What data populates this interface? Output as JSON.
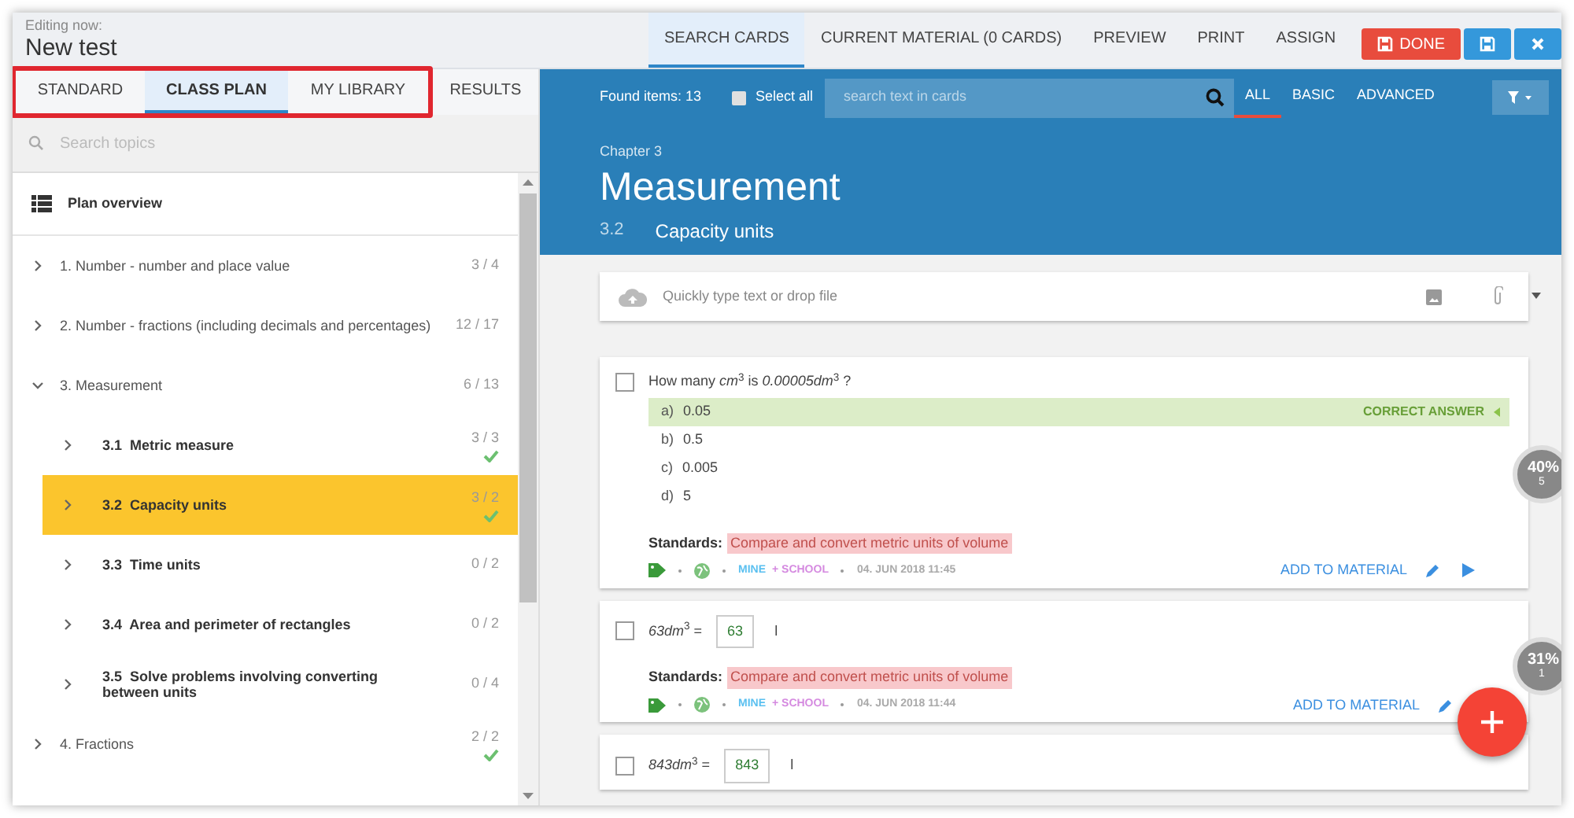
{
  "header": {
    "caption": "Editing now:",
    "title": "New test"
  },
  "top_tabs": [
    {
      "label": "SEARCH CARDS",
      "selected": true
    },
    {
      "label": "CURRENT MATERIAL (0 CARDS)",
      "selected": false
    },
    {
      "label": "PREVIEW",
      "selected": false
    },
    {
      "label": "PRINT",
      "selected": false
    },
    {
      "label": "ASSIGN",
      "selected": false
    }
  ],
  "actions": [
    {
      "kind": "done",
      "label": "DONE"
    },
    {
      "kind": "save"
    },
    {
      "kind": "close"
    }
  ],
  "side_tabs": [
    {
      "label": "STANDARD",
      "selected": false,
      "highlighted": true
    },
    {
      "label": "CLASS PLAN",
      "selected": true,
      "highlighted": true
    },
    {
      "label": "MY LIBRARY",
      "selected": false,
      "highlighted": true
    },
    {
      "label": "RESULTS",
      "selected": false,
      "highlighted": false
    }
  ],
  "topic_search": {
    "placeholder": "Search topics"
  },
  "plan_overview": {
    "label": "Plan overview"
  },
  "topics": [
    {
      "title": "1. Number - number and place value",
      "count": "3 / 4",
      "expanded": false,
      "done": false,
      "selected": false
    },
    {
      "title": "2. Number - fractions (including decimals and percentages)",
      "count": "12 / 17",
      "expanded": false,
      "done": false,
      "selected": false
    },
    {
      "title": "3. Measurement",
      "count": "6 / 13",
      "expanded": true,
      "done": false,
      "selected": false,
      "children": [
        {
          "number": "3.1",
          "title": "Metric measure",
          "count": "3 / 3",
          "expanded": false,
          "done": true,
          "selected": false
        },
        {
          "number": "3.2",
          "title": "Capacity units",
          "count": "3 / 2",
          "expanded": false,
          "done": true,
          "selected": true
        },
        {
          "number": "3.3",
          "title": "Time units",
          "count": "0 / 2",
          "expanded": false,
          "done": false,
          "selected": false
        },
        {
          "number": "3.4",
          "title": "Area and perimeter of rectangles",
          "count": "0 / 2",
          "expanded": false,
          "done": false,
          "selected": false
        },
        {
          "number": "3.5",
          "title": "Solve problems involving converting between units",
          "count": "0 / 4",
          "expanded": false,
          "done": false,
          "selected": false
        }
      ]
    },
    {
      "title": "4. Fractions",
      "count": "2 / 2",
      "expanded": false,
      "done": true,
      "selected": false
    }
  ],
  "toolbar": {
    "found": "Found items: 13",
    "select_all": {
      "label": "Select all",
      "checked": false
    },
    "search_placeholder": "search text in cards",
    "filters": [
      {
        "label": "ALL",
        "selected": true
      },
      {
        "label": "BASIC",
        "selected": false
      },
      {
        "label": "ADVANCED",
        "selected": false
      }
    ]
  },
  "chapter": {
    "caption": "Chapter 3",
    "title": "Measurement",
    "number": "3.2",
    "subtitle": "Capacity units"
  },
  "quick_input": {
    "placeholder": "Quickly type text or drop file"
  },
  "cards": [
    {
      "kind": "choice",
      "checked": false,
      "question": "How many *cm*$^{3}$ is *0.00005dm*$^{3}$ ?",
      "correct_label": "CORRECT ANSWER",
      "options": [
        {
          "letter": "a)",
          "text": "0.05",
          "correct": true
        },
        {
          "letter": "b)",
          "text": "0.5",
          "correct": false
        },
        {
          "letter": "c)",
          "text": "0.005",
          "correct": false
        },
        {
          "letter": "d)",
          "text": "5",
          "correct": false
        }
      ],
      "standards_label": "Standards:",
      "standard": "Compare and convert metric units of volume",
      "owner": "MINE",
      "share": "+ SCHOOL",
      "date": "04. JUN 2018 11:45",
      "action": "ADD TO MATERIAL",
      "play_button": true,
      "stat": {
        "percent": "40%",
        "count": "5"
      }
    },
    {
      "kind": "fill",
      "checked": false,
      "question": "*63dm*$^{3}$ =",
      "answer": "63",
      "unit": "l",
      "standards_label": "Standards:",
      "standard": "Compare and convert metric units of volume",
      "owner": "MINE",
      "share": "+ SCHOOL",
      "date": "04. JUN 2018 11:44",
      "action": "ADD TO MATERIAL",
      "stat": {
        "percent": "31%",
        "count": "1"
      }
    },
    {
      "kind": "fill",
      "checked": false,
      "question": "*843dm*$^{3}$ =",
      "answer": "843",
      "unit": "l"
    }
  ]
}
